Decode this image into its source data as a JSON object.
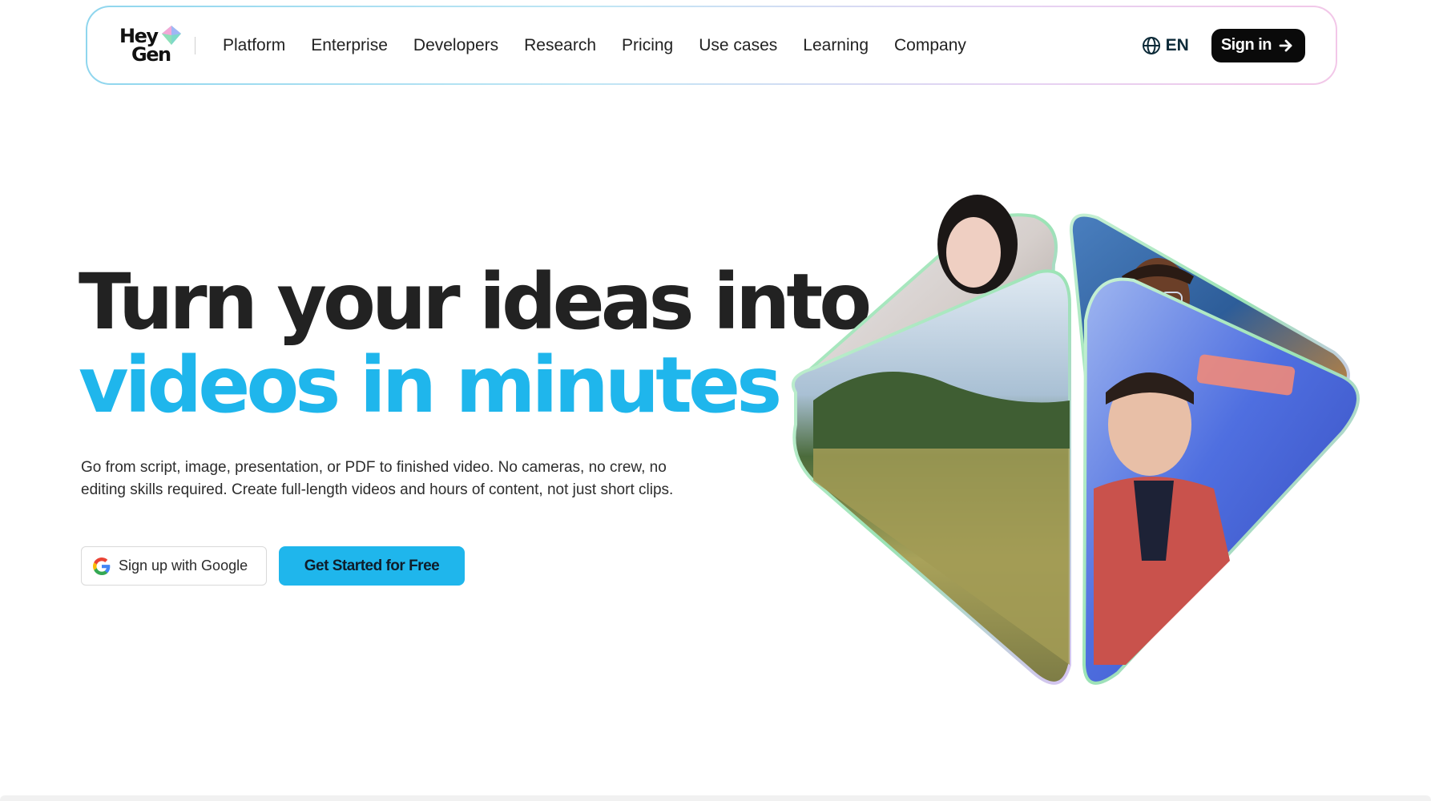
{
  "brand": {
    "logo_line1": "Hey",
    "logo_line2": "Gen"
  },
  "nav": {
    "items": [
      {
        "label": "Platform"
      },
      {
        "label": "Enterprise"
      },
      {
        "label": "Developers"
      },
      {
        "label": "Research"
      },
      {
        "label": "Pricing"
      },
      {
        "label": "Use cases"
      },
      {
        "label": "Learning"
      },
      {
        "label": "Company"
      }
    ],
    "language": "EN",
    "language_icon": "globe-icon",
    "signin_label": "Sign in",
    "signin_icon": "arrow-right-icon"
  },
  "hero": {
    "title_line1": "Turn your ideas into",
    "title_line2": "videos in minutes",
    "description": "Go from script, image, presentation, or PDF to finished video. No cameras, no crew, no editing skills required. Create full-length videos and hours of content, not just short clips.",
    "google_button": "Sign up with Google",
    "google_icon": "google-icon",
    "cta_button": "Get Started for Free"
  },
  "colors": {
    "accent": "#1fb6ec",
    "title_dark": "#222222",
    "signin_bg": "#0a0a0a"
  }
}
